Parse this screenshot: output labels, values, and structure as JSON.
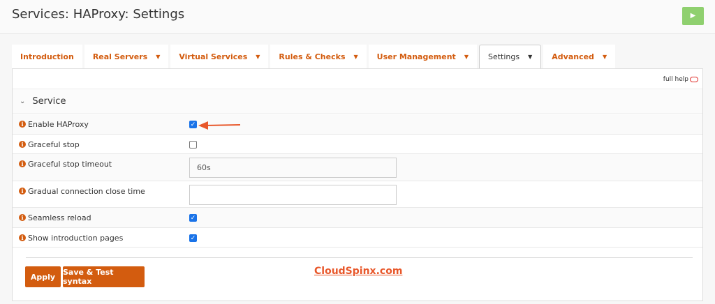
{
  "header": {
    "title": "Services: HAProxy: Settings",
    "play_icon": "▶"
  },
  "tabs": [
    {
      "label": "Introduction",
      "dropdown": false
    },
    {
      "label": "Real Servers",
      "dropdown": true
    },
    {
      "label": "Virtual Services",
      "dropdown": true
    },
    {
      "label": "Rules & Checks",
      "dropdown": true
    },
    {
      "label": "User Management",
      "dropdown": true
    },
    {
      "label": "Settings",
      "dropdown": true,
      "active": true
    },
    {
      "label": "Advanced",
      "dropdown": true
    }
  ],
  "caret": "▼",
  "full_help": "full help",
  "section": {
    "title": "Service",
    "chevron": "⌄"
  },
  "fields": [
    {
      "label": "Enable HAProxy",
      "type": "checkbox",
      "checked": true
    },
    {
      "label": "Graceful stop",
      "type": "checkbox",
      "checked": false
    },
    {
      "label": "Graceful stop timeout",
      "type": "text",
      "value": "60s"
    },
    {
      "label": "Gradual connection close time",
      "type": "text",
      "value": ""
    },
    {
      "label": "Seamless reload",
      "type": "checkbox",
      "checked": true
    },
    {
      "label": "Show introduction pages",
      "type": "checkbox",
      "checked": true
    }
  ],
  "buttons": {
    "apply": "Apply",
    "save_test": "Save & Test syntax"
  },
  "watermark": "CloudSpinx.com",
  "colors": {
    "accent": "#d35c0f",
    "checkbox": "#1a73e8",
    "play": "#8fd06f",
    "arrow": "#e8572a"
  }
}
